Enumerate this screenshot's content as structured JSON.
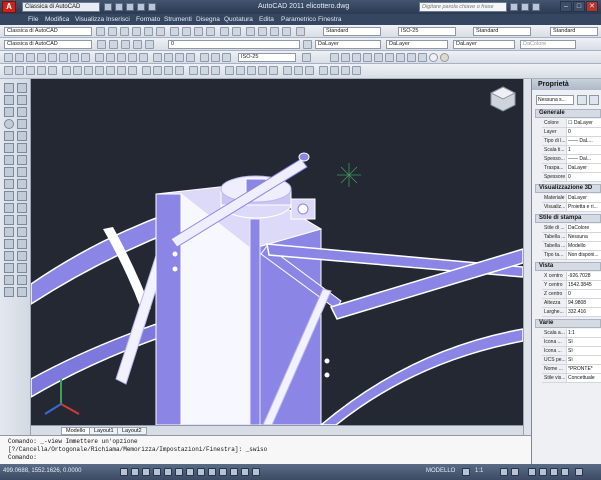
{
  "titlebar": {
    "logo_letter": "A",
    "workspace": "Classica di AutoCAD",
    "title": "AutoCAD 2011    elicottero.dwg",
    "search_placeholder": "Digitare parola chiave o frase",
    "close_glyph": "✕",
    "max_glyph": "□",
    "min_glyph": "–"
  },
  "menu": [
    "File",
    "Modifica",
    "Visualizza",
    "Inserisci",
    "Formato",
    "Strumenti",
    "Disegna",
    "Quotatura",
    "Edita",
    "Parametrico",
    "Finestra"
  ],
  "toolbar1": {
    "workspace_combo": "Classica di AutoCAD",
    "textstyle": "Standard",
    "dimstyle": "ISO-25",
    "tablestyle": "Standard",
    "mleaderstyle": "Standard"
  },
  "toolbar2": {
    "workspace_combo": "Classica di AutoCAD",
    "layer": "0",
    "color": "DaLayer",
    "linetype": "DaLayer",
    "lineweight": "DaLayer",
    "plotstyle": "DaColore"
  },
  "toolbar3": {
    "dimstyle": "ISO-25"
  },
  "tabs": [
    "Modello",
    "Layout1",
    "Layout2"
  ],
  "viewcube_label": "",
  "properties": {
    "title": "Proprietà",
    "selection": "Nessuna s...",
    "sections": [
      {
        "name": "Generale",
        "rows": [
          {
            "key": "Colore",
            "value": "☐ DaLayer"
          },
          {
            "key": "Layer",
            "value": "0"
          },
          {
            "key": "Tipo di l...",
            "value": "—— DaL..."
          },
          {
            "key": "Scala ti...",
            "value": "1"
          },
          {
            "key": "Spesso...",
            "value": "—— Dal..."
          },
          {
            "key": "Traspa...",
            "value": "DaLayer"
          },
          {
            "key": "Spessore",
            "value": "0"
          }
        ]
      },
      {
        "name": "Visualizzazione 3D",
        "rows": [
          {
            "key": "Materiale",
            "value": "DaLayer"
          },
          {
            "key": "Visualiz...",
            "value": "Proietta e ri..."
          }
        ]
      },
      {
        "name": "Stile di stampa",
        "rows": [
          {
            "key": "Stile di ...",
            "value": "DaColore"
          },
          {
            "key": "Tabella ...",
            "value": "Nessuna"
          },
          {
            "key": "Tabella ...",
            "value": "Modello"
          },
          {
            "key": "Tipo ta...",
            "value": "Non disponi..."
          }
        ]
      },
      {
        "name": "Vista",
        "rows": [
          {
            "key": "X centro",
            "value": "-926.7028"
          },
          {
            "key": "Y centro",
            "value": "1542.3845"
          },
          {
            "key": "Z centro",
            "value": "0"
          },
          {
            "key": "Altezza",
            "value": "94.9808"
          },
          {
            "key": "Larghe...",
            "value": "332.416"
          }
        ]
      },
      {
        "name": "Varie",
        "rows": [
          {
            "key": "Scala a...",
            "value": "1:1"
          },
          {
            "key": "Icona ...",
            "value": "Sì"
          },
          {
            "key": "Icona ...",
            "value": "Sì"
          },
          {
            "key": "UCS pe...",
            "value": "Sì"
          },
          {
            "key": "Nome ...",
            "value": "*PRONTE*"
          },
          {
            "key": "Stile vis...",
            "value": "Concettuale"
          }
        ]
      }
    ]
  },
  "command": {
    "line1": "Comando: _-view Immettere un'opzione",
    "line2": "[?/Cancella/Ortogonale/Richiama/Memorizza/Impostazioni/Finestra]: _swiso",
    "line3": "Comando:"
  },
  "status": {
    "coords": "499.0688, 1552.1626, 0.0000",
    "mode": "MODELLO",
    "scale": "1:1"
  },
  "colors": {
    "model_face": "#8b86e6",
    "model_light": "#ffffff",
    "viewport_bg": "#232833"
  }
}
